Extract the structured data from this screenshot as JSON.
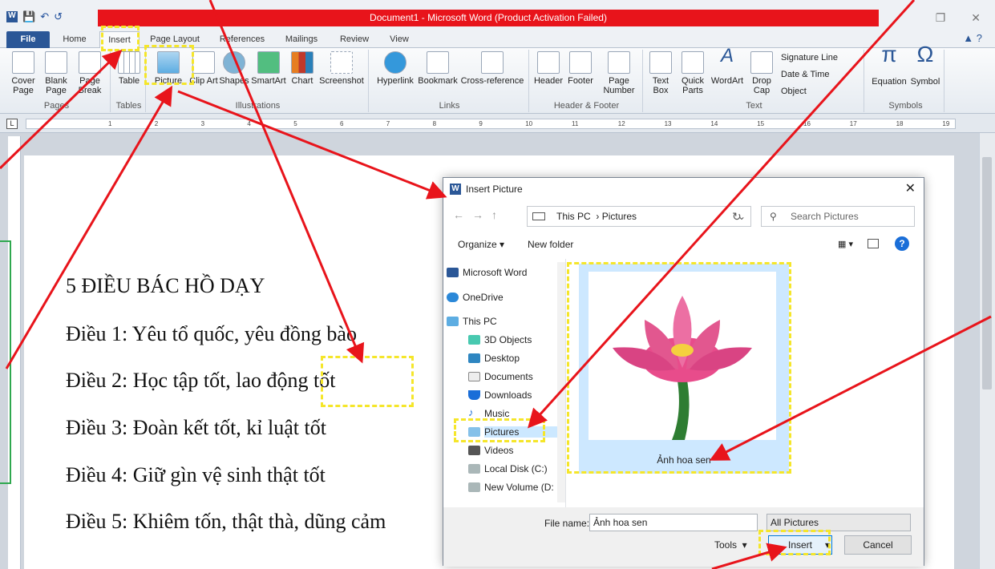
{
  "window": {
    "title": "Document1 - Microsoft Word (Product Activation Failed)"
  },
  "tabs": [
    "File",
    "Home",
    "Insert",
    "Page Layout",
    "References",
    "Mailings",
    "Review",
    "View"
  ],
  "ribbon": {
    "pages": {
      "cover": "Cover Page",
      "blank": "Blank Page",
      "break": "Page Break",
      "label": "Pages"
    },
    "tables": {
      "table": "Table",
      "label": "Tables"
    },
    "illustrations": {
      "picture": "Picture",
      "clipart": "Clip Art",
      "shapes": "Shapes",
      "smartart": "SmartArt",
      "chart": "Chart",
      "screenshot": "Screenshot",
      "label": "Illustrations"
    },
    "links": {
      "hyperlink": "Hyperlink",
      "bookmark": "Bookmark",
      "crossref": "Cross-reference",
      "label": "Links"
    },
    "hf": {
      "header": "Header",
      "footer": "Footer",
      "pagenumber": "Page Number",
      "label": "Header & Footer"
    },
    "text": {
      "textbox": "Text Box",
      "quickparts": "Quick Parts",
      "wordart": "WordArt",
      "dropcap": "Drop Cap",
      "signature": "Signature Line",
      "datetime": "Date & Time",
      "object": "Object",
      "label": "Text"
    },
    "symbols": {
      "equation": "Equation",
      "symbol": "Symbol",
      "label": "Symbols"
    }
  },
  "ruler": [
    "1",
    "2",
    "3",
    "4",
    "5",
    "6",
    "7",
    "8",
    "9",
    "10",
    "11",
    "12",
    "13",
    "14",
    "15",
    "16",
    "17",
    "18",
    "19"
  ],
  "document": {
    "lines": [
      "5 ĐIỀU BÁC HỒ DẠY",
      "Điều 1: Yêu tổ quốc, yêu đồng bào",
      "Điều 2: Học tập tốt, lao động tốt",
      "Điều 3: Đoàn kết tốt, kỉ luật tốt",
      "Điều 4: Giữ gìn vệ sinh thật tốt",
      "Điều 5: Khiêm tốn, thật thà, dũng cảm"
    ]
  },
  "dialog": {
    "title": "Insert Picture",
    "path": [
      "This PC",
      "Pictures"
    ],
    "search_placeholder": "Search Pictures",
    "organize": "Organize",
    "new_folder": "New folder",
    "nav": [
      "Microsoft Word",
      "OneDrive",
      "This PC",
      "3D Objects",
      "Desktop",
      "Documents",
      "Downloads",
      "Music",
      "Pictures",
      "Videos",
      "Local Disk (C:)",
      "New Volume (D:"
    ],
    "file_caption": "Ảnh hoa sen",
    "file_name_label": "File name:",
    "file_name_value": "Ảnh hoa sen",
    "filter": "All Pictures",
    "tools": "Tools",
    "insert": "Insert",
    "cancel": "Cancel"
  }
}
